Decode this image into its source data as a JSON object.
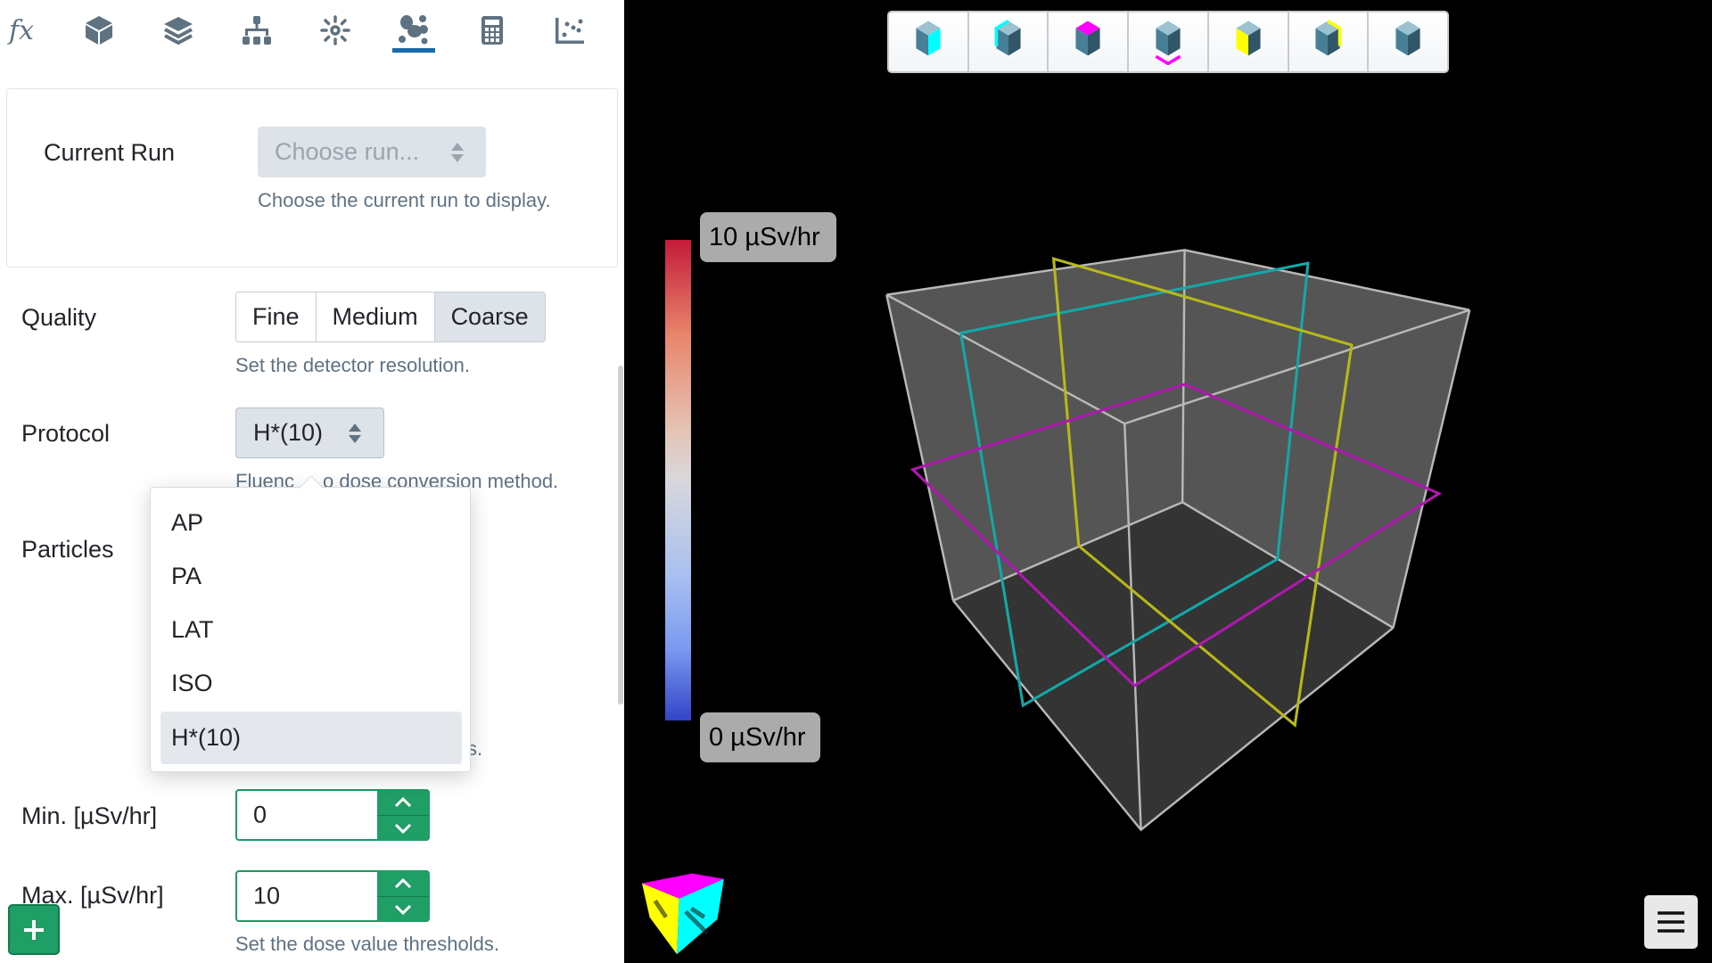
{
  "toolbar": {
    "icons": [
      "function-icon",
      "box-icon",
      "layers-icon",
      "hierarchy-icon",
      "radiation-icon",
      "particles-icon",
      "calculator-icon",
      "scatter-chart-icon"
    ],
    "fx_label": "fx",
    "active_index": 5,
    "accent": "#1769aa"
  },
  "current_run": {
    "label": "Current Run",
    "placeholder": "Choose run...",
    "help": "Choose the current run to display."
  },
  "quality": {
    "label": "Quality",
    "options": [
      "Fine",
      "Medium",
      "Coarse"
    ],
    "selected": "Coarse",
    "help": "Set the detector resolution."
  },
  "protocol": {
    "label": "Protocol",
    "value": "H*(10)",
    "help_left": "Fluenc",
    "help_right": "o dose conversion method.",
    "options": [
      "AP",
      "PA",
      "LAT",
      "ISO",
      "H*(10)"
    ],
    "selected": "H*(10)"
  },
  "particles": {
    "label": "Particles",
    "help_fragment": "s."
  },
  "min": {
    "label": "Min. [µSv/hr]",
    "value": "0"
  },
  "max": {
    "label": "Max. [µSv/hr]",
    "value": "10"
  },
  "threshold_help": "Set the dose value thresholds.",
  "view_buttons": [
    "view-front-icon",
    "view-back-icon",
    "view-top-icon",
    "view-bottom-icon",
    "view-left-icon",
    "view-right-icon",
    "view-iso-icon"
  ],
  "colorbar": {
    "max_label": "10 µSv/hr",
    "min_label": "0 µSv/hr",
    "min": 0,
    "max": 10
  },
  "colors": {
    "green": "#1f9e66",
    "cyan": "#00ffff",
    "magenta": "#ff00ff",
    "yellow": "#ffff00"
  }
}
